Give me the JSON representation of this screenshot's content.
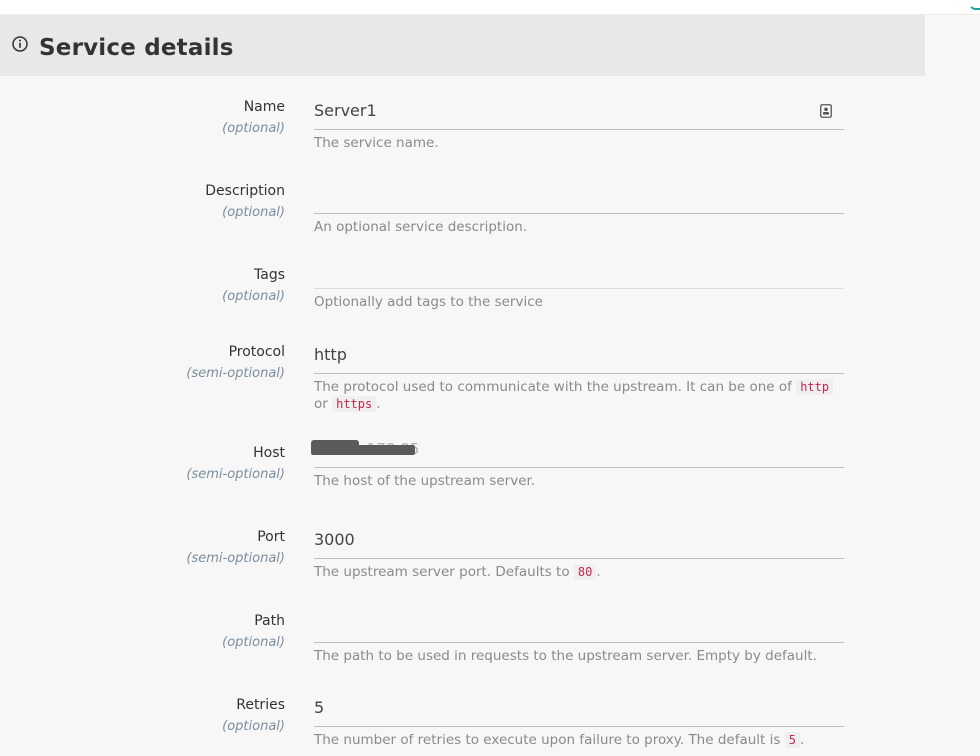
{
  "header": {
    "title": "Service details",
    "icon": "info-icon"
  },
  "fields": [
    {
      "label": "Name",
      "qualifier": "(optional)",
      "value": "Server1",
      "help": "The service name."
    },
    {
      "label": "Description",
      "qualifier": "(optional)",
      "value": "",
      "help": "An optional service description."
    },
    {
      "label": "Tags",
      "qualifier": "(optional)",
      "value": "",
      "help": "Optionally add tags to the service"
    },
    {
      "label": "Protocol",
      "qualifier": "(semi-optional)",
      "value": "http",
      "help_prefix": "The protocol used to communicate with the upstream. It can be one of",
      "help_code_1": "http",
      "help_or": "or",
      "help_code_2": "https",
      "help_suffix": "."
    },
    {
      "label": "Host",
      "qualifier": "(semi-optional)",
      "value_visible_fragment": ".178.85",
      "help": "The host of the upstream server."
    },
    {
      "label": "Port",
      "qualifier": "(semi-optional)",
      "value": "3000",
      "help_prefix": "The upstream server port. Defaults to",
      "help_code": "80",
      "help_suffix": "."
    },
    {
      "label": "Path",
      "qualifier": "(optional)",
      "value": "",
      "help": "The path to be used in requests to the upstream server. Empty by default."
    },
    {
      "label": "Retries",
      "qualifier": "(optional)",
      "value": "5",
      "help_prefix": "The number of retries to execute upon failure to proxy. The default is",
      "help_code": "5",
      "help_suffix": "."
    }
  ],
  "colors": {
    "code": "#c7254e",
    "accent": "#1aa39a"
  }
}
